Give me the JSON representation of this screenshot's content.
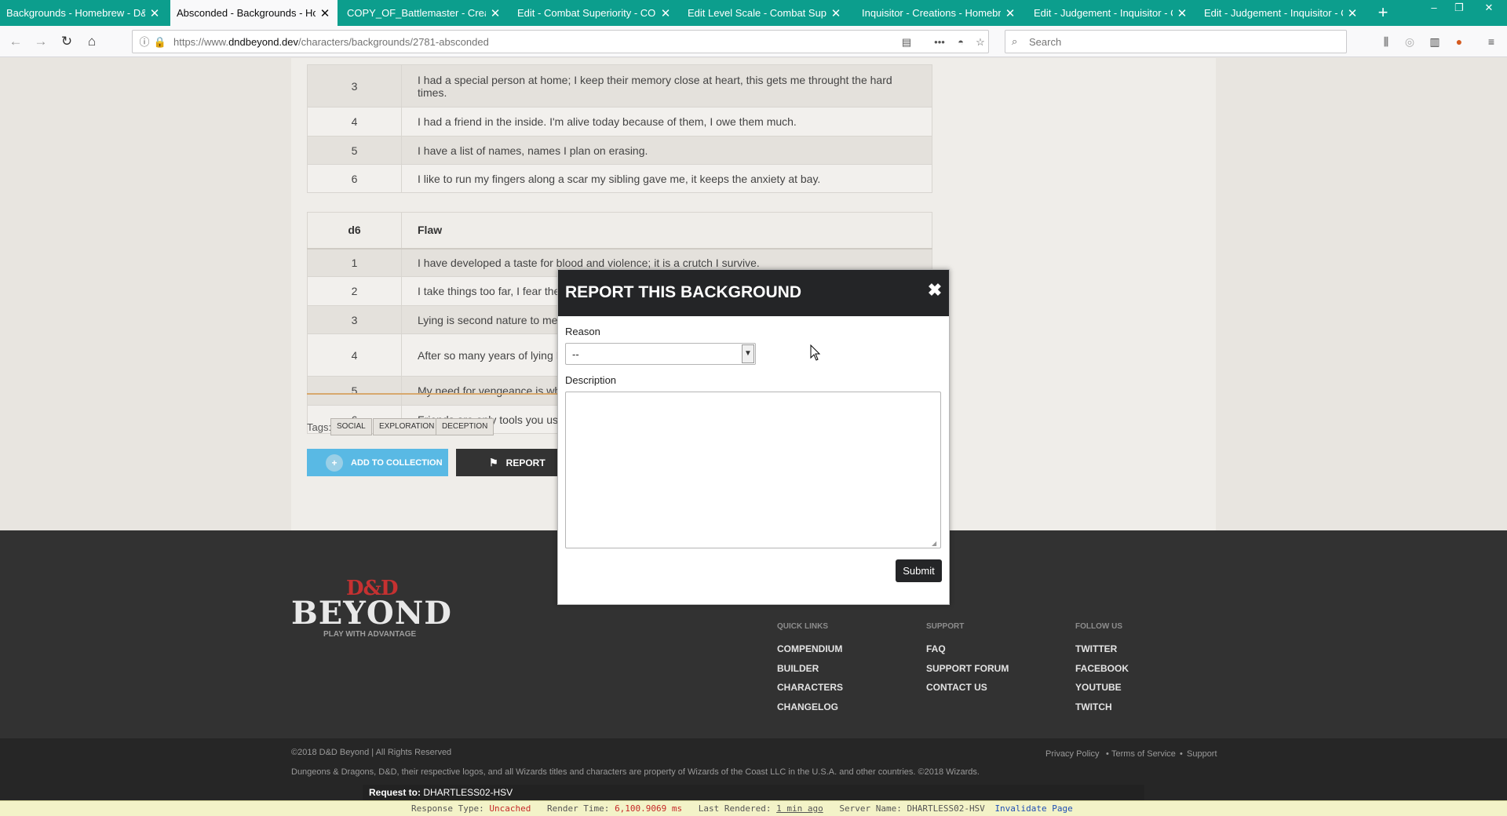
{
  "browser": {
    "tabs": [
      {
        "title": "Backgrounds - Homebrew - D&D"
      },
      {
        "title": "Absconded - Backgrounds - Hom"
      },
      {
        "title": "COPY_OF_Battlemaster - Creation"
      },
      {
        "title": "Edit - Combat Superiority - COPY"
      },
      {
        "title": "Edit Level Scale - Combat Superio"
      },
      {
        "title": "Inquisitor - Creations - Homebrew"
      },
      {
        "title": "Edit - Judgement - Inquisitor - Cre"
      },
      {
        "title": "Edit - Judgement - Inquisitor - Cre"
      }
    ],
    "url_prefix": "https://www.",
    "url_domain": "dndbeyond.dev",
    "url_path": "/characters/backgrounds/2781-absconded",
    "search_placeholder": "Search"
  },
  "bond_rows": [
    {
      "n": "3",
      "text": "I had a special person at home; I keep their memory close at heart, this gets me throught the hard times."
    },
    {
      "n": "4",
      "text": "I had a friend in the inside. I'm alive today because of them, I owe them much."
    },
    {
      "n": "5",
      "text": "I have a list of names, names I plan on erasing."
    },
    {
      "n": "6",
      "text": "I like to run my fingers along a scar my sibling gave me, it keeps the anxiety at bay."
    }
  ],
  "flaw_table": {
    "head_die": "d6",
    "head_label": "Flaw",
    "rows": [
      {
        "n": "1",
        "text": "I have developed a taste for blood and violence; it is a crutch I survive."
      },
      {
        "n": "2",
        "text": "I take things too far, I fear the"
      },
      {
        "n": "3",
        "text": "Lying is second nature to me"
      },
      {
        "n": "4",
        "text": "After so many years of lying I remember who I really am."
      },
      {
        "n": "5",
        "text": "My need for vengeance is wh"
      },
      {
        "n": "6",
        "text": "Friends are only tools you us"
      }
    ]
  },
  "tags": {
    "label": "Tags:",
    "items": [
      "SOCIAL",
      "EXPLORATION",
      "DECEPTION"
    ]
  },
  "actions": {
    "add_collection": "ADD TO COLLECTION",
    "report": "REPORT"
  },
  "modal": {
    "title": "REPORT THIS BACKGROUND",
    "reason_label": "Reason",
    "reason_value": "--",
    "description_label": "Description",
    "description_value": "",
    "submit": "Submit"
  },
  "footer": {
    "logo_top": "D&D",
    "logo_main": "BEYOND",
    "logo_tagline": "PLAY WITH ADVANTAGE",
    "columns": [
      {
        "head": "QUICK LINKS",
        "links": [
          "COMPENDIUM",
          "BUILDER",
          "CHARACTERS",
          "CHANGELOG"
        ]
      },
      {
        "head": "SUPPORT",
        "links": [
          "FAQ",
          "SUPPORT FORUM",
          "CONTACT US"
        ]
      },
      {
        "head": "FOLLOW US",
        "links": [
          "TWITTER",
          "FACEBOOK",
          "YOUTUBE",
          "TWITCH"
        ]
      }
    ],
    "copyright": "©2018 D&D Beyond | All Rights Reserved",
    "legal": "Dungeons & Dragons, D&D, their respective logos, and all Wizards titles and characters are property of Wizards of the Coast LLC in the U.S.A. and other countries. ©2018 Wizards.",
    "legal_links": [
      "Privacy Policy",
      "Terms of Service",
      "Support"
    ]
  },
  "debug": {
    "request_label": "Request to:",
    "request_value": "DHARTLESS02-HSV",
    "response_type_label": "Response Type:",
    "response_type_value": "Uncached",
    "render_time_label": "Render Time:",
    "render_time_value": "6,100.9069 ms",
    "last_rendered_label": "Last Rendered:",
    "last_rendered_value": "1 min ago",
    "server_name_label": "Server Name:",
    "server_name_value": "DHARTLESS02-HSV",
    "invalidate": "Invalidate Page"
  },
  "colors": {
    "tab_strip": "#0c9e8d",
    "modal_header": "#242527",
    "add_collection": "#59b9e4",
    "divider": "#d7a86e"
  }
}
